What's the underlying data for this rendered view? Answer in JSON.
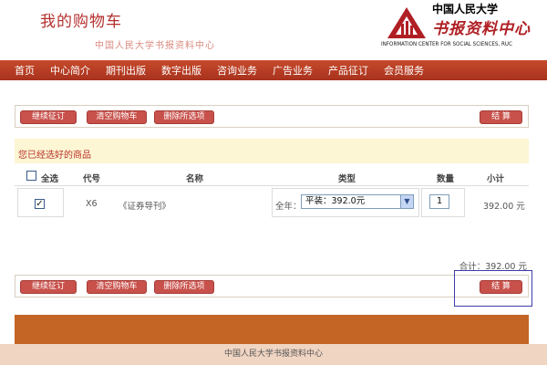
{
  "header": {
    "title": "我的购物车",
    "subtitle": "中国人民大学书报资料中心"
  },
  "logo": {
    "cn_name": "中国人民大学",
    "brand": "书报资料中心",
    "en_name": "INFORMATION CENTER FOR SOCIAL SCIENCES, RUC"
  },
  "nav": {
    "items": [
      "首页",
      "中心简介",
      "期刊出版",
      "数字出版",
      "咨询业务",
      "广告业务",
      "产品征订",
      "会员服务"
    ]
  },
  "toolbar": {
    "continue_label": "继续征订",
    "clear_label": "清空购物车",
    "delete_label": "删除所选项",
    "checkout_label": "结 算"
  },
  "cart": {
    "heading": "您已经选好的商品",
    "columns": {
      "select_all": "全选",
      "code": "代号",
      "name": "名称",
      "type": "类型",
      "quantity": "数量",
      "subtotal": "小计"
    },
    "rows": [
      {
        "checked": "✓",
        "code": "X6",
        "name": "《证券导刊》",
        "period": "全年：",
        "edition": "平装：392.0元",
        "quantity": "1",
        "subtotal": "392.00 元"
      }
    ],
    "total": "合计：392.00 元"
  },
  "footer": {
    "text": "中国人民大学书报资料中心"
  },
  "colors": {
    "brand_red": "#b3302e",
    "nav_red": "#b83a22",
    "button_red": "#c8514b",
    "heading_bar": "#fdf6d4",
    "orange_band": "#c46425",
    "footer_bg": "#f1d5c3"
  }
}
